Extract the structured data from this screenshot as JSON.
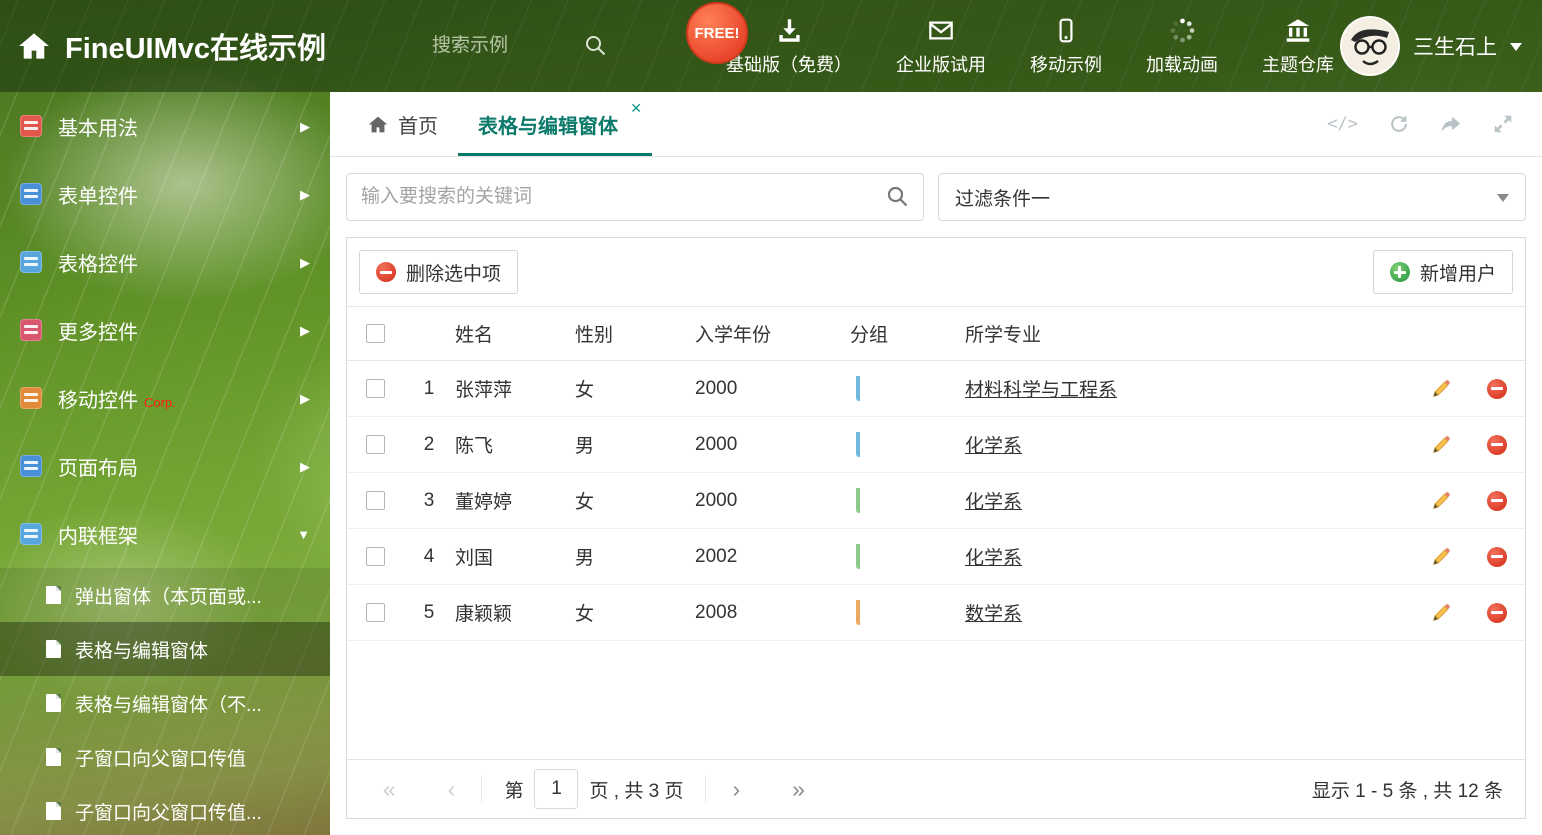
{
  "accent": "#0c7a6a",
  "header": {
    "title": "FineUIMvc在线示例",
    "search_placeholder": "搜索示例",
    "free_badge": "FREE!",
    "nav": [
      {
        "label": "基础版（免费）",
        "icon": "download-icon"
      },
      {
        "label": "企业版试用",
        "icon": "mail-icon"
      },
      {
        "label": "移动示例",
        "icon": "mobile-icon"
      },
      {
        "label": "加载动画",
        "icon": "spinner-icon"
      },
      {
        "label": "主题仓库",
        "icon": "bank-icon"
      }
    ],
    "user_name": "三生石上"
  },
  "sidebar": {
    "items": [
      {
        "label": "基本用法",
        "icon": "home-icon",
        "icon_color": "#e2574c",
        "arrow": "▶"
      },
      {
        "label": "表单控件",
        "icon": "form-icon",
        "icon_color": "#4a90d9",
        "arrow": "▶"
      },
      {
        "label": "表格控件",
        "icon": "grid-icon",
        "icon_color": "#58a7dc",
        "arrow": "▶"
      },
      {
        "label": "更多控件",
        "icon": "widgets-icon",
        "icon_color": "#d9566f",
        "arrow": "▶"
      },
      {
        "label": "移动控件",
        "badge": "Corp.",
        "icon": "mobile-icon",
        "icon_color": "#e08a3a",
        "arrow": "▶"
      },
      {
        "label": "页面布局",
        "icon": "layout-icon",
        "icon_color": "#4a90d9",
        "arrow": "▶"
      },
      {
        "label": "内联框架",
        "icon": "frame-icon",
        "icon_color": "#58a7dc",
        "arrow": "▼",
        "expanded": true
      }
    ],
    "subitems": [
      {
        "label": "弹出窗体（本页面或..."
      },
      {
        "label": "表格与编辑窗体",
        "active": true
      },
      {
        "label": "表格与编辑窗体（不..."
      },
      {
        "label": "子窗口向父窗口传值"
      },
      {
        "label": "子窗口向父窗口传值..."
      }
    ]
  },
  "main": {
    "tabs": {
      "home": "首页",
      "active": "表格与编辑窗体"
    },
    "search_placeholder": "输入要搜索的关键词",
    "filter_value": "过滤条件一",
    "toolbar": {
      "delete_label": "删除选中项",
      "add_label": "新增用户"
    },
    "table": {
      "columns": {
        "name": "姓名",
        "gender": "性别",
        "year": "入学年份",
        "group": "分组",
        "major": "所学专业"
      },
      "rows": [
        {
          "num": "1",
          "name": "张萍萍",
          "gender": "女",
          "year": "2000",
          "tag_bg": "#dff0fa",
          "tag_border": "#6fb9e0",
          "major": "材料科学与工程系"
        },
        {
          "num": "2",
          "name": "陈飞",
          "gender": "男",
          "year": "2000",
          "tag_bg": "#dff0fa",
          "tag_border": "#6fb9e0",
          "major": "化学系"
        },
        {
          "num": "3",
          "name": "董婷婷",
          "gender": "女",
          "year": "2000",
          "tag_bg": "#e3f3e0",
          "tag_border": "#8cc98a",
          "major": "化学系"
        },
        {
          "num": "4",
          "name": "刘国",
          "gender": "男",
          "year": "2002",
          "tag_bg": "#e3f3e0",
          "tag_border": "#8cc98a",
          "major": "化学系"
        },
        {
          "num": "5",
          "name": "康颖颖",
          "gender": "女",
          "year": "2008",
          "tag_bg": "#fcebd5",
          "tag_border": "#eda95f",
          "major": "数学系"
        }
      ]
    },
    "pagination": {
      "first": "«",
      "prev": "‹",
      "page_prefix": "第",
      "page_value": "1",
      "page_suffix": "页 , 共 3 页",
      "next": "›",
      "last": "»",
      "summary": "显示 1 - 5 条 , 共 12 条"
    }
  }
}
